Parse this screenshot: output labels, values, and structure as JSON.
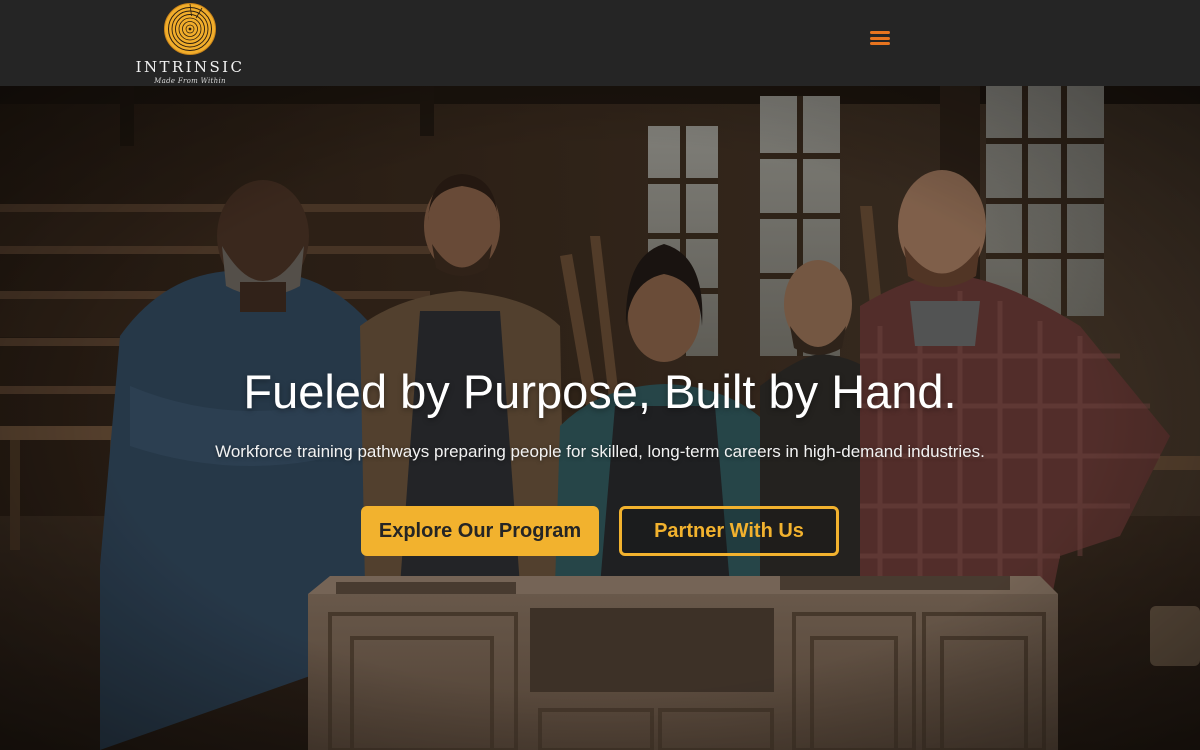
{
  "header": {
    "brand_name": "INTRINSIC",
    "tagline": "Made From Within",
    "menu_icon": "hamburger-menu-icon",
    "menu_color": "#e8741f"
  },
  "hero": {
    "title": "Fueled by Purpose, Built by Hand.",
    "subtitle": "Workforce training pathways preparing people for skilled, long-term careers in high-demand industries.",
    "primary_button_label": "Explore Our Program",
    "secondary_button_label": "Partner With Us",
    "background_image": "five woodworkers standing behind a wooden cabinet in a workshop",
    "accent_color": "#f2b22e"
  }
}
